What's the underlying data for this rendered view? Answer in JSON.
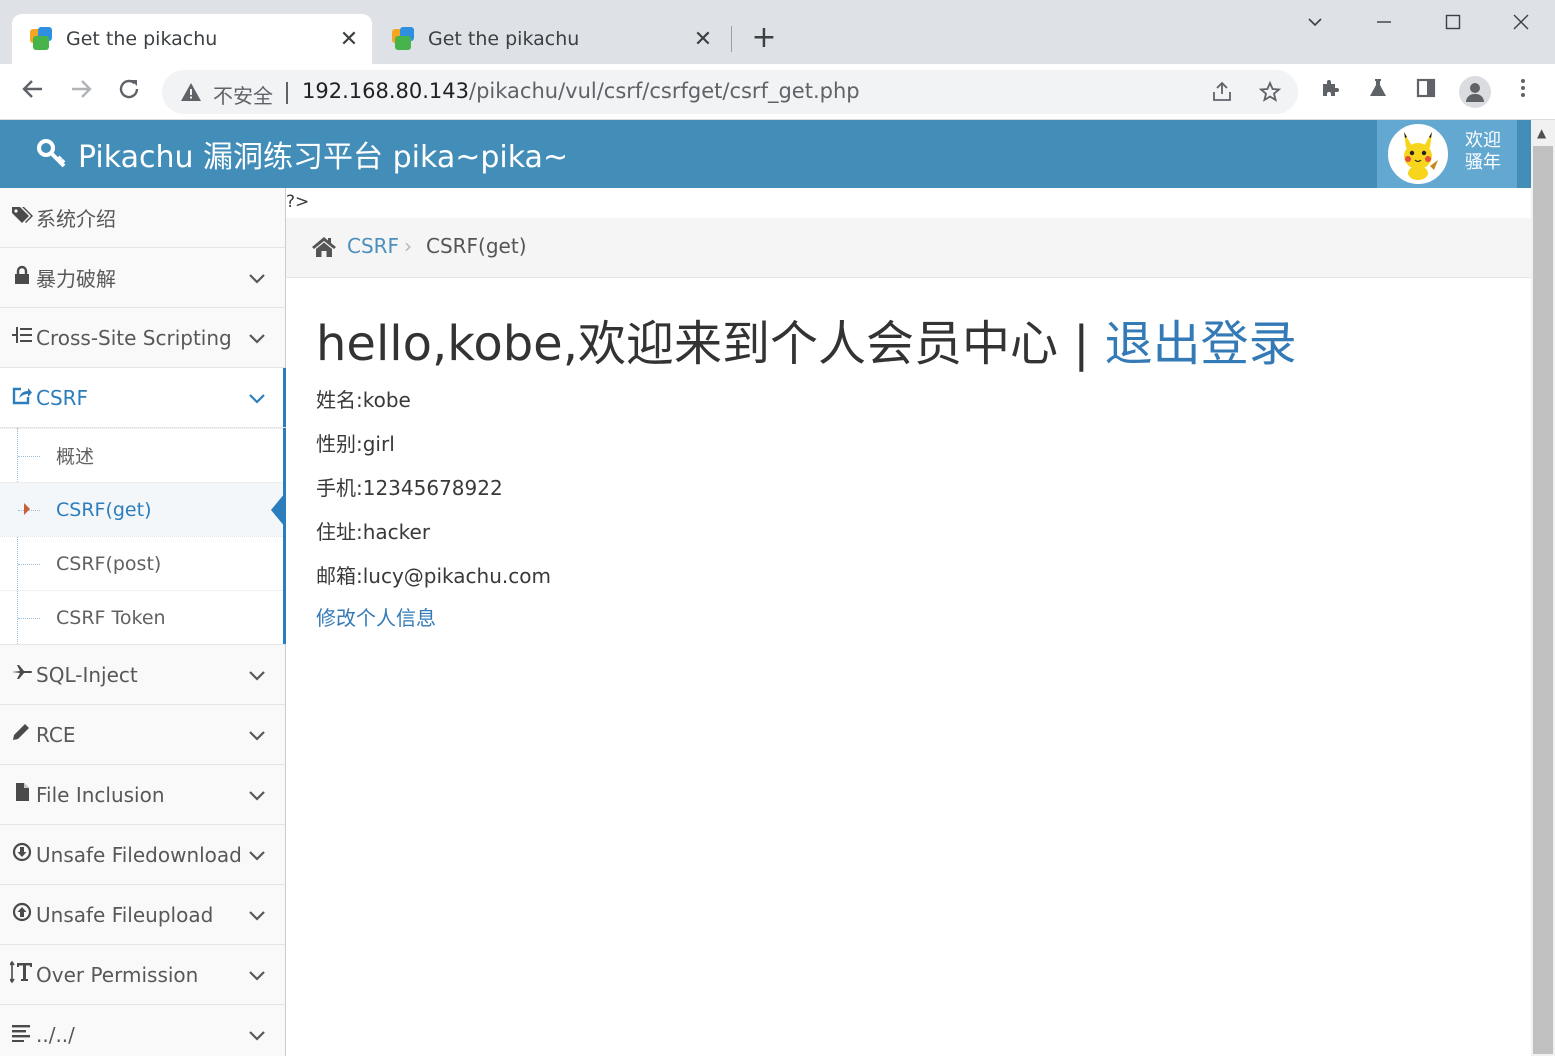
{
  "browser": {
    "tabs": [
      {
        "title": "Get the pikachu",
        "active": true
      },
      {
        "title": "Get the pikachu",
        "active": false
      }
    ],
    "close_glyph": "✕",
    "newtab_glyph": "+",
    "address": {
      "security_label": "不安全",
      "host": "192.168.80.143",
      "path": "/pikachu/vul/csrf/csrfget/csrf_get.php"
    },
    "icons": [
      "back-icon",
      "forward-icon",
      "reload-icon",
      "warning-icon",
      "share-icon",
      "star-icon",
      "extensions-icon",
      "labs-icon",
      "sidepanel-icon",
      "profile-icon",
      "menu-icon",
      "minimize-icon",
      "maximize-icon",
      "close-icon",
      "tab-search-icon"
    ]
  },
  "header": {
    "brand": "Pikachu 漏洞练习平台 pika~pika~",
    "welcome": "欢迎 骚年",
    "color": "#438eb9"
  },
  "sidebar": {
    "items": [
      {
        "label": "系统介绍",
        "icon": "tags-icon",
        "has_children": false
      },
      {
        "label": "暴力破解",
        "icon": "lock-icon",
        "has_children": true
      },
      {
        "label": "Cross-Site Scripting",
        "icon": "list-tree-icon",
        "has_children": true
      },
      {
        "label": "CSRF",
        "icon": "share-square-icon",
        "has_children": true,
        "open": true
      },
      {
        "label": "SQL-Inject",
        "icon": "plane-icon",
        "has_children": true
      },
      {
        "label": "RCE",
        "icon": "pencil-icon",
        "has_children": true
      },
      {
        "label": "File Inclusion",
        "icon": "file-icon",
        "has_children": true
      },
      {
        "label": "Unsafe Filedownload",
        "icon": "download-circle-icon",
        "has_children": true
      },
      {
        "label": "Unsafe Fileupload",
        "icon": "upload-circle-icon",
        "has_children": true
      },
      {
        "label": "Over Permission",
        "icon": "text-height-icon",
        "has_children": true
      },
      {
        "label": "../../",
        "icon": "align-left-icon",
        "has_children": true
      }
    ],
    "csrf_children": [
      {
        "label": "概述",
        "active": false
      },
      {
        "label": "CSRF(get)",
        "active": true
      },
      {
        "label": "CSRF(post)",
        "active": false
      },
      {
        "label": "CSRF Token",
        "active": false
      }
    ]
  },
  "main": {
    "php_leak": "?>",
    "breadcrumb": {
      "link": "CSRF",
      "separator": "›",
      "current": "CSRF(get)"
    },
    "headline": "hello,kobe,欢迎来到个人会员中心 | ",
    "logout": "退出登录",
    "info": [
      "姓名:kobe",
      "性别:girl",
      "手机:12345678922",
      "住址:hacker",
      "邮箱:lucy@pikachu.com"
    ],
    "edit_link": "修改个人信息"
  }
}
